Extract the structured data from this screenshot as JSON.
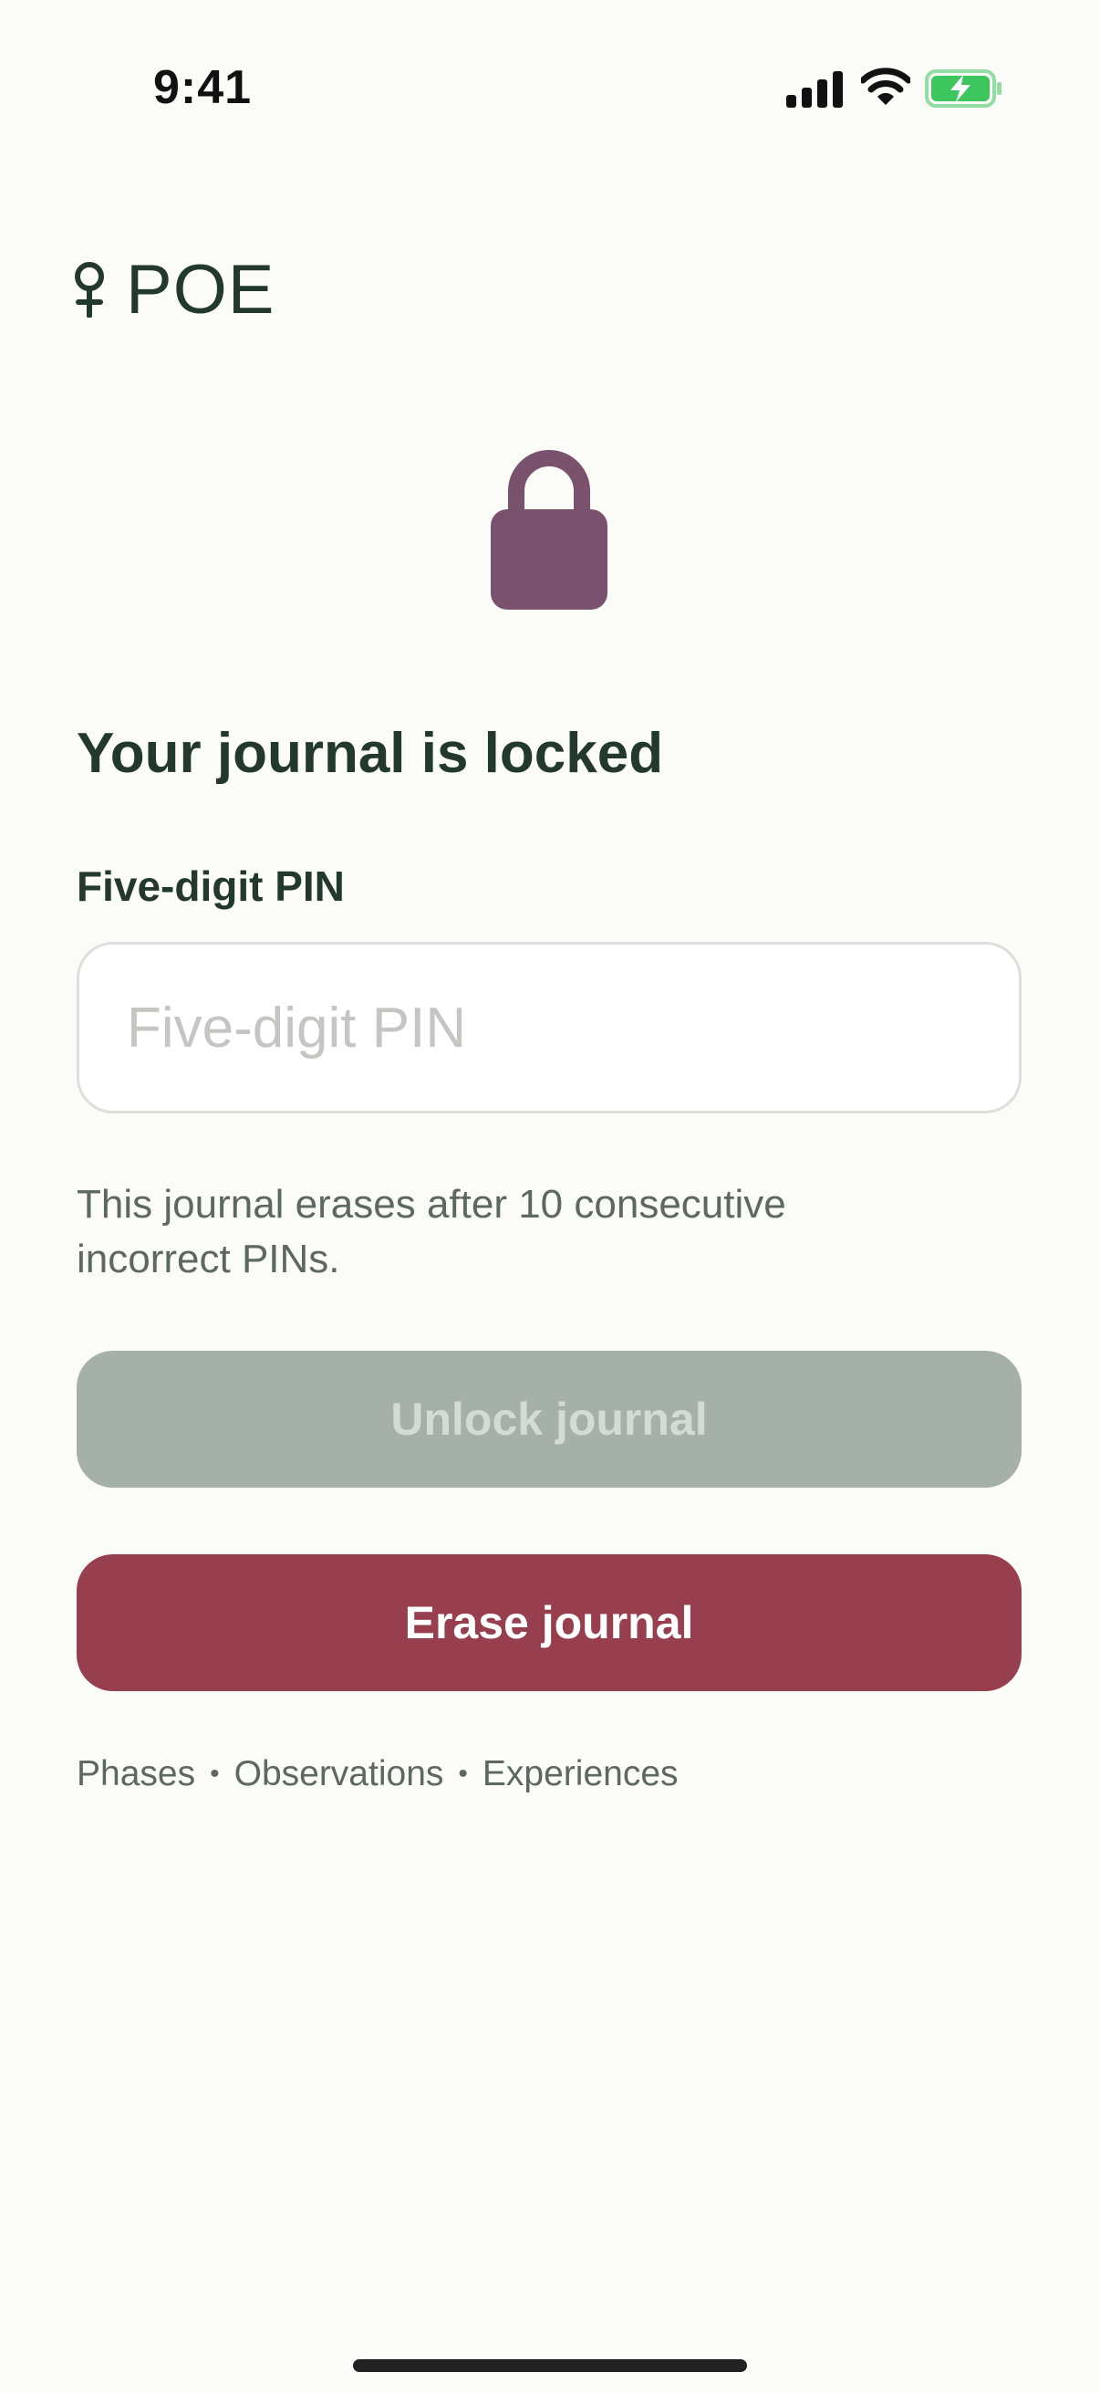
{
  "status_bar": {
    "time": "9:41",
    "icons": [
      "cellular-signal-icon",
      "wifi-icon",
      "battery-charging-icon"
    ],
    "battery_color": "#3DC55E"
  },
  "app": {
    "logo_text": "POE",
    "logo_icon": "venus-symbol-icon"
  },
  "lock": {
    "icon": "lock-icon",
    "color": "#7A526E"
  },
  "title": "Your journal is locked",
  "pin": {
    "label": "Five-digit PIN",
    "placeholder": "Five-digit PIN",
    "value": ""
  },
  "helper_text": "This journal erases after 10 consecutive incorrect PINs.",
  "buttons": {
    "unlock_label": "Unlock journal",
    "unlock_color": "#A5B0A9",
    "erase_label": "Erase journal",
    "erase_color": "#973F4E"
  },
  "footer": {
    "links": [
      "Phases",
      "Observations",
      "Experiences"
    ],
    "separator": "•"
  },
  "colors": {
    "background": "#FBFBF7",
    "primary_text": "#23392F",
    "secondary_text": "#5D6862"
  }
}
